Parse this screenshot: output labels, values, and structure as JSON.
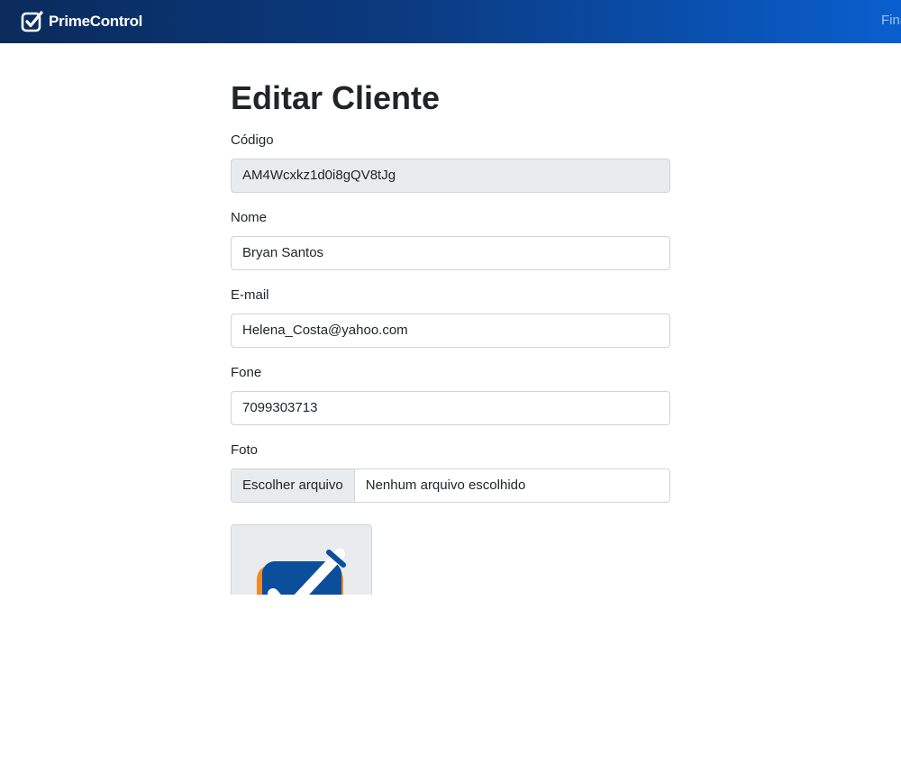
{
  "navbar": {
    "brand": "PrimeControl",
    "nav_link": "Fina",
    "brand_icon": "checkbox-check-icon",
    "colors": {
      "gradient_start": "#0a2b5c",
      "gradient_end": "#0a5fcf"
    }
  },
  "page": {
    "title": "Editar Cliente"
  },
  "form": {
    "codigo": {
      "label": "Código",
      "value": "AM4Wcxkz1d0i8gQV8tJg"
    },
    "nome": {
      "label": "Nome",
      "value": "Bryan Santos"
    },
    "email": {
      "label": "E-mail",
      "value": "Helena_Costa@yahoo.com"
    },
    "fone": {
      "label": "Fone",
      "value": "7099303713"
    },
    "foto": {
      "label": "Foto",
      "button": "Escolher arquivo",
      "status": "Nenhum arquivo escolhido"
    },
    "photo_preview_icon": "primecontrol-logo-icon"
  }
}
